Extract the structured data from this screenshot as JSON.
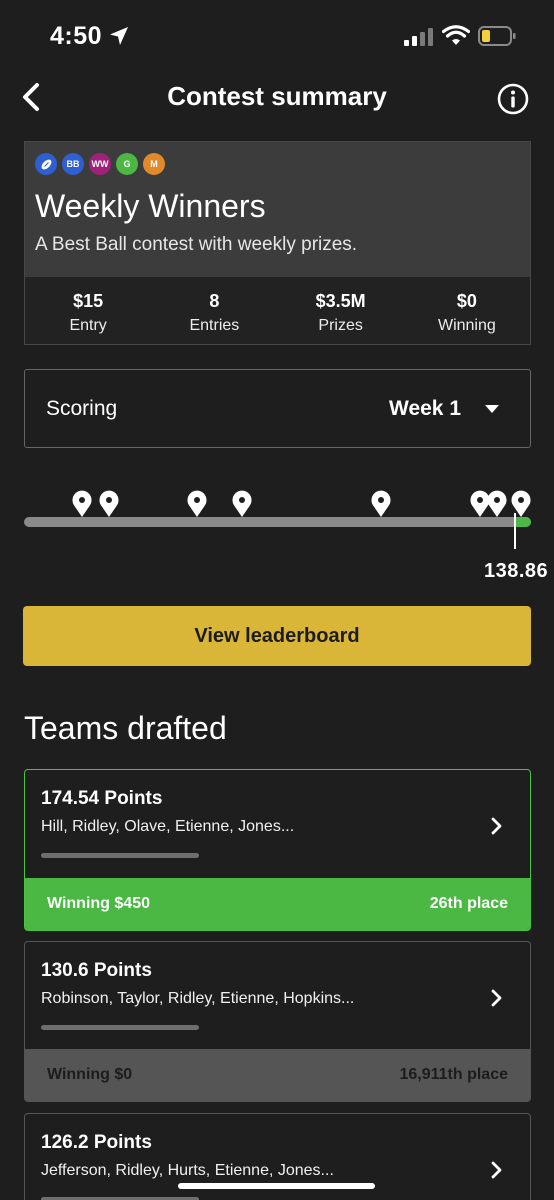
{
  "status_bar": {
    "time": "4:50"
  },
  "header": {
    "title": "Contest summary"
  },
  "contest": {
    "badges": [
      {
        "text": "",
        "icon": "football-icon",
        "color": "#2f5fd0"
      },
      {
        "text": "BB",
        "color": "#2f5fd0"
      },
      {
        "text": "WW",
        "color": "#a0207a"
      },
      {
        "text": "G",
        "color": "#4cb843"
      },
      {
        "text": "M",
        "color": "#e08a2c"
      }
    ],
    "name": "Weekly Winners",
    "description": "A Best Ball contest with weekly prizes.",
    "stats": [
      {
        "value": "$15",
        "label": "Entry"
      },
      {
        "value": "8",
        "label": "Entries"
      },
      {
        "value": "$3.5M",
        "label": "Prizes"
      },
      {
        "value": "$0",
        "label": "Winning"
      }
    ]
  },
  "scoring": {
    "label": "Scoring",
    "selected": "Week 1"
  },
  "progress": {
    "score": "138.86"
  },
  "leaderboard_button": "View leaderboard",
  "teams": {
    "title": "Teams drafted",
    "items": [
      {
        "points": "174.54 Points",
        "players": "Hill, Ridley, Olave, Etienne, Jones...",
        "winning": "Winning $450",
        "place": "26th place"
      },
      {
        "points": "130.6 Points",
        "players": "Robinson, Taylor, Ridley, Etienne, Hopkins...",
        "winning": "Winning $0",
        "place": "16,911th place"
      },
      {
        "points": "126.2 Points",
        "players": "Jefferson, Ridley, Hurts, Etienne, Jones..."
      }
    ]
  },
  "colors": {
    "accent_yellow": "#d9b637",
    "win_green": "#4ab842",
    "background": "#1e1e1e"
  }
}
